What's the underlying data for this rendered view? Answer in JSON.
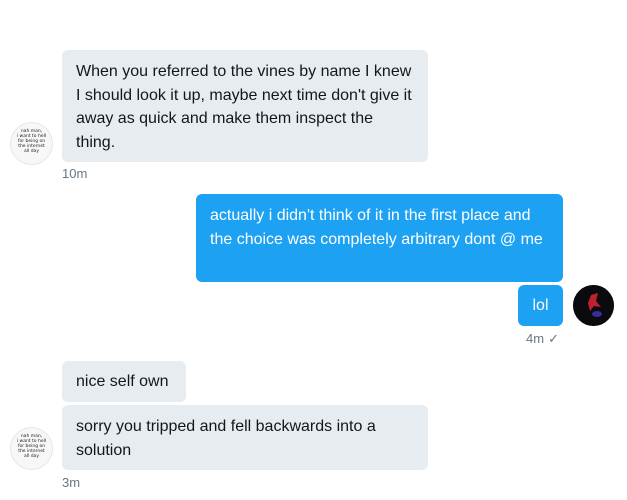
{
  "messages": [
    {
      "text": "When you referred to the vines by name I knew I should look it up, maybe next time don't give it away as quick and make them inspect the thing."
    },
    {
      "text": "actually i didn't think of it in the first place and the choice was completely arbitrary dont @ me"
    },
    {
      "text": "lol"
    },
    {
      "text": "nice self own"
    },
    {
      "text": "sorry you tripped and fell backwards into a solution"
    }
  ],
  "timestamps": {
    "first": "10m",
    "second": "4m",
    "third": "3m"
  },
  "avatar_left_text": "nah man, i want to hell for being on the internet all day",
  "colors": {
    "outgoing": "#1da1f2",
    "incoming": "#e6ecf0",
    "meta": "#657786"
  }
}
